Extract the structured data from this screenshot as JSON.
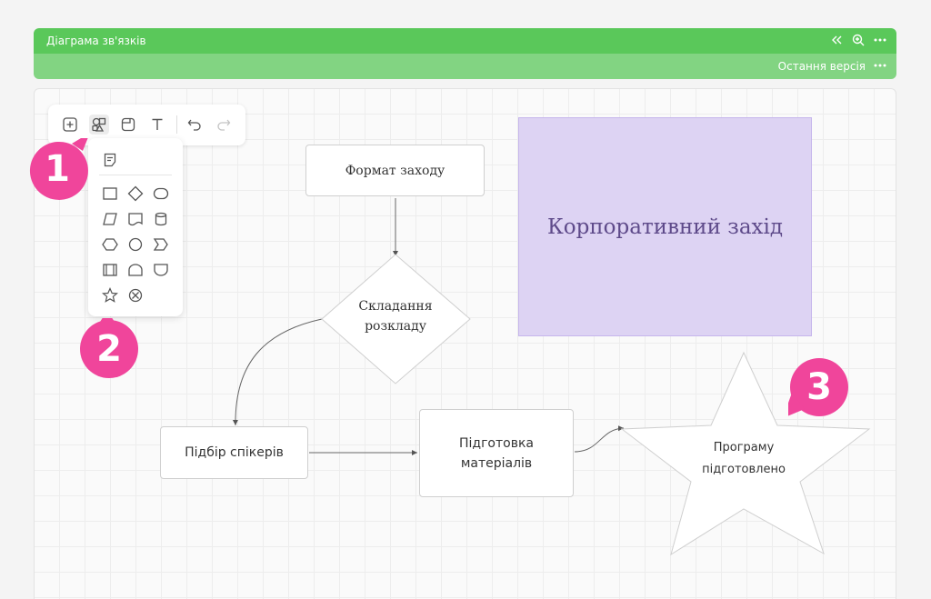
{
  "header": {
    "title": "Діаграма зв'язків",
    "icons": [
      "collapse-icon",
      "zoom-icon",
      "more-icon"
    ],
    "version_label": "Остання версія",
    "color_top": "#5ac85a",
    "color_bottom": "#82d482"
  },
  "toolbar": {
    "tools": [
      "add-icon",
      "shapes-icon",
      "sticky-note-icon",
      "text-icon",
      "undo-icon",
      "redo-icon"
    ],
    "active_tool": "shapes-icon"
  },
  "palette": {
    "shapes": [
      "note",
      "rectangle",
      "diamond",
      "ellipse",
      "parallelogram",
      "document",
      "cylinder",
      "hexagon",
      "circle",
      "chevron",
      "process",
      "rounded-top",
      "rounded-bottom",
      "star",
      "cross-circle"
    ]
  },
  "badges": [
    {
      "label": "1",
      "color": "#f0459b"
    },
    {
      "label": "2",
      "color": "#f0459b"
    },
    {
      "label": "3",
      "color": "#f0459b"
    }
  ],
  "diagram": {
    "nodes": {
      "format": "Формат заходу",
      "schedule": "Складання розкладу",
      "speakers": "Підбір спікерів",
      "materials": "Підготовка матеріалів",
      "program": "Програму підготовлено",
      "corporate": "Корпоративний захід"
    },
    "corporate_color": "#ddd3f3"
  }
}
